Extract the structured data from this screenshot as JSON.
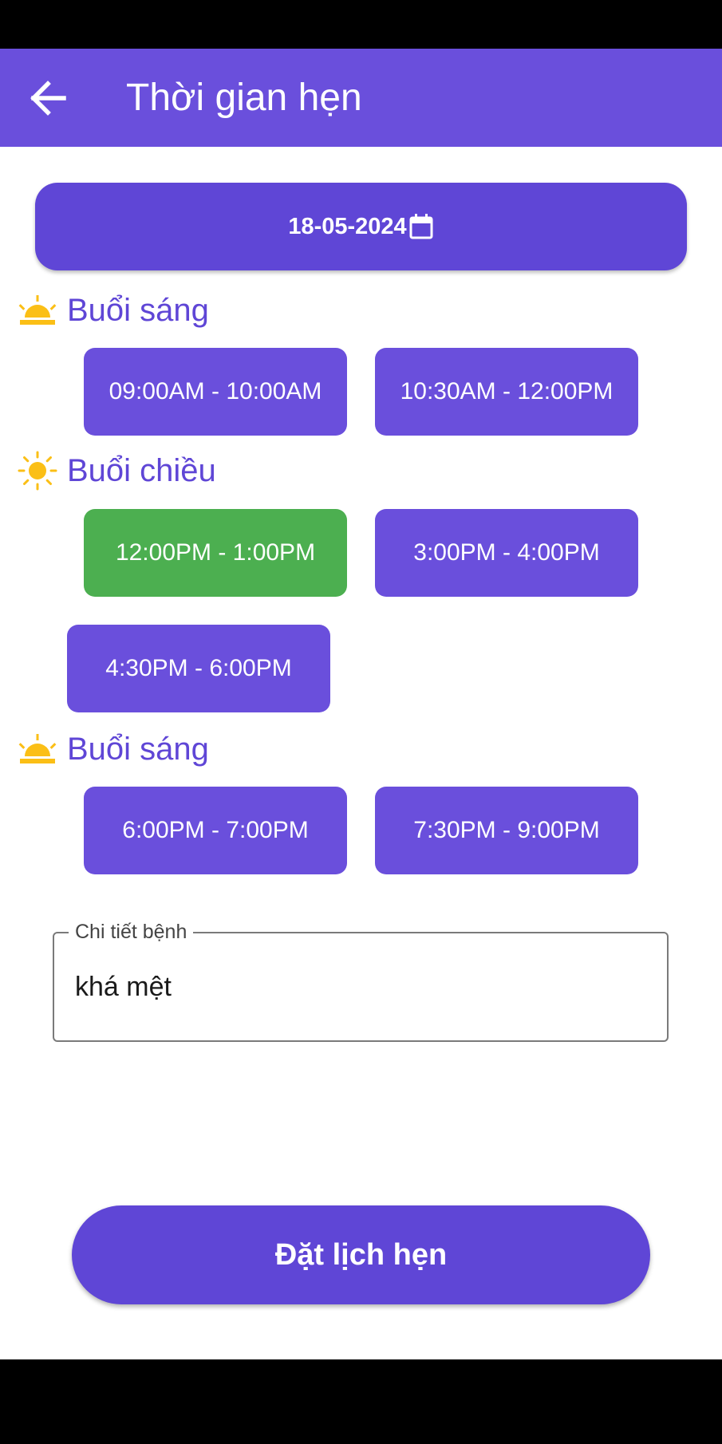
{
  "app_bar": {
    "title": "Thời gian hẹn",
    "back_icon": "arrow-back-icon"
  },
  "date_picker": {
    "value": "18-05-2024",
    "icon": "calendar-icon"
  },
  "sections": [
    {
      "label": "Buổi sáng",
      "icon": "sunrise-icon",
      "slots": [
        {
          "label": "09:00AM - 10:00AM",
          "selected": false
        },
        {
          "label": "10:30AM - 12:00PM",
          "selected": false
        }
      ]
    },
    {
      "label": "Buổi chiều",
      "icon": "sun-icon",
      "slots": [
        {
          "label": "12:00PM - 1:00PM",
          "selected": true
        },
        {
          "label": "3:00PM - 4:00PM",
          "selected": false
        },
        {
          "label": "4:30PM - 6:00PM",
          "selected": false
        }
      ]
    },
    {
      "label": "Buổi sáng",
      "icon": "sunrise-icon",
      "slots": [
        {
          "label": "6:00PM - 7:00PM",
          "selected": false
        },
        {
          "label": "7:30PM - 9:00PM",
          "selected": false
        }
      ]
    }
  ],
  "details_field": {
    "label": "Chi tiết bệnh",
    "value": "khá mệt"
  },
  "submit_button": {
    "label": "Đặt lịch hẹn"
  },
  "colors": {
    "primary": "#6a4fdc",
    "button": "#5f46d6",
    "selected": "#4caf50",
    "icon_sun": "#fbbf16"
  }
}
